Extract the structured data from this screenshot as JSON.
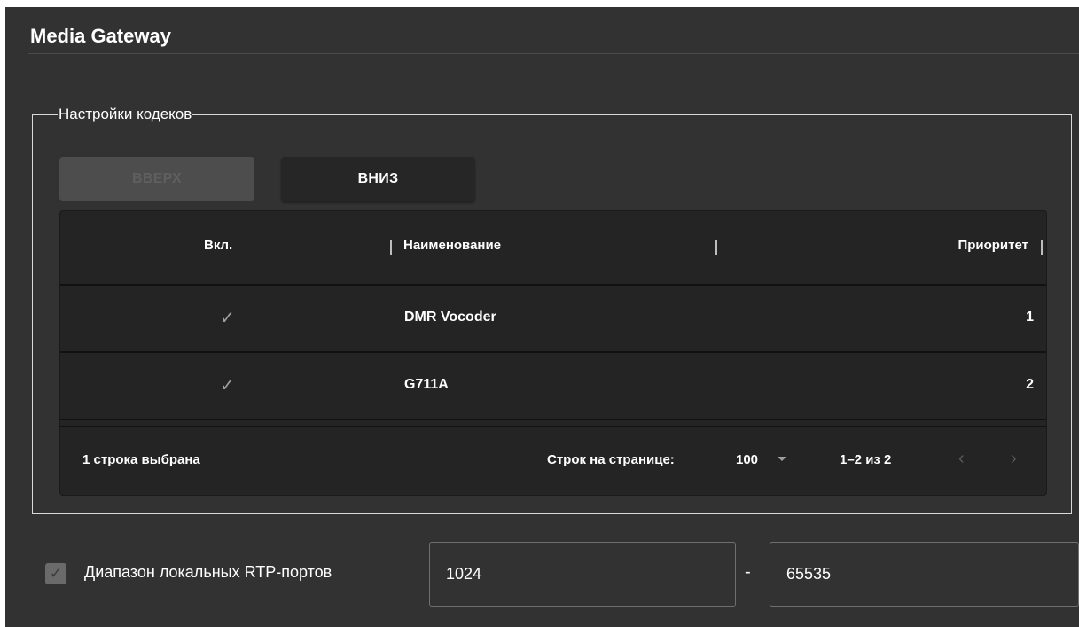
{
  "page": {
    "title": "Media Gateway"
  },
  "codecs": {
    "legend": "Настройки кодеков",
    "buttons": {
      "up": "ВВЕРХ",
      "down": "ВНИЗ"
    },
    "table": {
      "columns": [
        "Вкл.",
        "Наименование",
        "Приоритет"
      ],
      "rows": [
        {
          "enabled": "✓",
          "name": "DMR Vocoder",
          "priority": "1"
        },
        {
          "enabled": "✓",
          "name": "G711A",
          "priority": "2"
        }
      ]
    },
    "footer": {
      "selected": "1 строка выбрана",
      "rows_per_page_label": "Строк на странице:",
      "rows_per_page_value": "100",
      "range": "1–2 из 2",
      "prev_icon": "chevron-left-icon",
      "next_icon": "chevron-right-icon"
    }
  },
  "rtp": {
    "checkbox_label": "Диапазон локальных RTP-портов",
    "checked": true,
    "from": "1024",
    "separator": "-",
    "to": "65535"
  },
  "colors": {
    "panel_bg": "#323232",
    "table_bg": "#242424",
    "button_dark": "#262626",
    "button_disabled": "#4d4d4d"
  }
}
